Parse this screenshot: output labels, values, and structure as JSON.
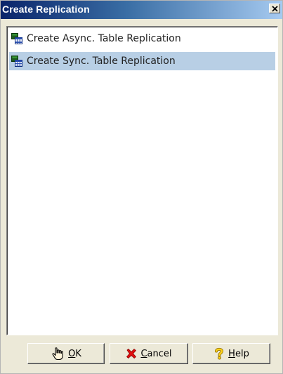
{
  "window": {
    "title": "Create Replication",
    "close_icon": "close-icon"
  },
  "list": {
    "items": [
      {
        "label": "Create Async. Table Replication",
        "icon": "table-icon",
        "selected": false
      },
      {
        "label": "Create Sync. Table Replication",
        "icon": "table-icon",
        "selected": true
      }
    ],
    "selection_color": "#b8cfe5"
  },
  "buttons": {
    "ok": {
      "mnemonic": "O",
      "rest": "K",
      "icon": "hand-pointer-icon"
    },
    "cancel": {
      "mnemonic": "C",
      "rest": "ancel",
      "icon": "red-x-icon"
    },
    "help": {
      "mnemonic": "H",
      "rest": "elp",
      "icon": "question-mark-icon"
    }
  },
  "colors": {
    "titlebar_start": "#0a246a",
    "titlebar_end": "#a6caf0",
    "dialog_bg": "#ece9d8"
  }
}
